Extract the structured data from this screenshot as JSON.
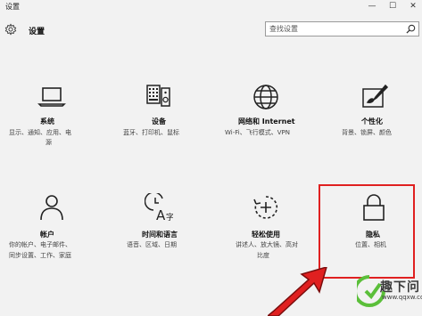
{
  "window": {
    "title": "设置",
    "buttons": {
      "minimize": "—",
      "maximize": "☐",
      "close": "✕"
    }
  },
  "header": {
    "title": "设置",
    "icon": "gear-icon"
  },
  "search": {
    "placeholder": "查找设置",
    "icon": "search-icon"
  },
  "tiles": [
    {
      "title": "系统",
      "desc": [
        "显示、通知、应用、电",
        "源"
      ],
      "icon": "laptop-icon"
    },
    {
      "title": "设备",
      "desc": [
        "蓝牙、打印机、鼠标"
      ],
      "icon": "keyboard-speaker-icon"
    },
    {
      "title": "网络和 Internet",
      "desc": [
        "Wi-Fi、飞行模式、VPN"
      ],
      "icon": "globe-icon"
    },
    {
      "title": "个性化",
      "desc": [
        "背景、锁屏、颜色"
      ],
      "icon": "paintbrush-icon"
    },
    {
      "title": "帐户",
      "desc": [
        "你的帐户、电子邮件、",
        "同步设置、工作、家庭"
      ],
      "icon": "person-icon"
    },
    {
      "title": "时间和语言",
      "desc": [
        "语音、区域、日期"
      ],
      "icon": "time-language-icon"
    },
    {
      "title": "轻松使用",
      "desc": [
        "讲述人、放大镜、高对",
        "比度"
      ],
      "icon": "ease-of-access-icon"
    },
    {
      "title": "隐私",
      "desc": [
        "位置、相机"
      ],
      "icon": "lock-icon"
    }
  ],
  "highlight": {
    "target": "隐私",
    "color": "#e02020"
  },
  "watermark": {
    "text": "趣下问",
    "url": "www.qqxw.com"
  }
}
